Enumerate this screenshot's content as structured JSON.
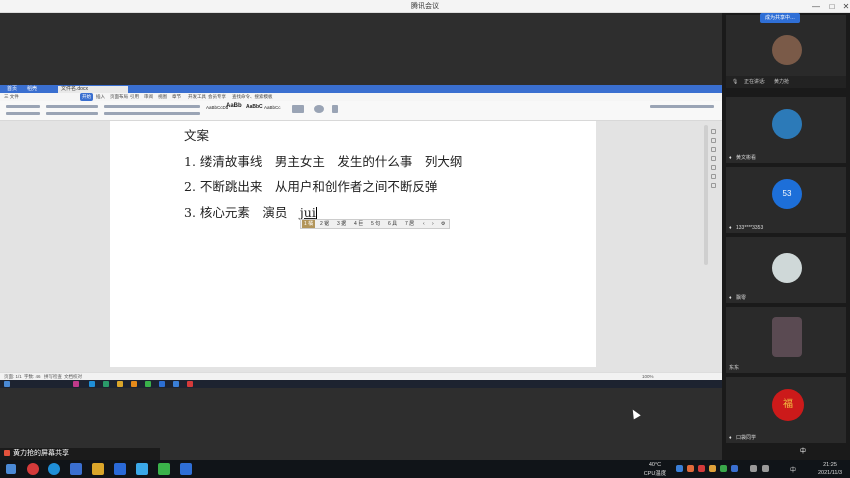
{
  "window": {
    "title": "腾讯会议",
    "controls": [
      "—",
      "□",
      "✕"
    ]
  },
  "share_pill": "成为共享中…",
  "wps": {
    "tabs": [
      "首页",
      "稻壳",
      "文件名.docx"
    ],
    "menu_items": [
      "三 文件",
      "开始",
      "插入",
      "页面布局",
      "引用",
      "审阅",
      "视图",
      "章节",
      "开发工具",
      "会员专享",
      "查找命令、搜索模板"
    ],
    "active_menu": "开始",
    "styles": [
      "AaBbCcDd",
      "AaBb",
      "AaBbC",
      "AaBbCc"
    ],
    "status": [
      "页面: 1/1",
      "字数: 46",
      "拼写检查",
      "文档校对"
    ],
    "zoom": "100%"
  },
  "doc": {
    "heading": "文案",
    "lines": [
      "1. 缕清故事线　男主女主　发生的什么事　列大纲",
      "2. 不断跳出来　从用户和创作者之间不断反弹",
      "3. 核心元素　演员　"
    ],
    "typed": "jui"
  },
  "ime": {
    "candidates": [
      "1 橘",
      "2 锯",
      "3 据",
      "4 巨",
      "5 句",
      "6 具",
      "7 居"
    ],
    "nav": [
      "‹",
      "›",
      "⚙"
    ]
  },
  "panel": {
    "speaking_label": "正在讲话:",
    "speaker": "黄力抢",
    "participants": [
      {
        "name": "黄力抢",
        "kind": "photo",
        "color": "#7a5a48"
      },
      {
        "name": "黄文彬看",
        "kind": "photo",
        "color": "#2c7ab8"
      },
      {
        "name": "133****3353",
        "kind": "number",
        "label": "53",
        "color": "#1d6fd9"
      },
      {
        "name": "飘零",
        "kind": "ghost",
        "color": "#cfd8d8"
      },
      {
        "name": "东东",
        "kind": "photo",
        "color": "#5a4a52"
      },
      {
        "name": "口袋同学",
        "kind": "fu",
        "label": "福",
        "color": "#cc1a1a"
      }
    ]
  },
  "share_notice": "黄力抢的屏幕共享",
  "taskbar": {
    "weather": "40°C",
    "weather_sub": "CPU温度",
    "time": "21:25",
    "date": "2021/11/3",
    "ime_indicator": "中"
  },
  "colors": {
    "wps_blue": "#3a6fd0",
    "meeting_blue": "#2f6fd6",
    "ime_highlight": "#b2955a"
  }
}
